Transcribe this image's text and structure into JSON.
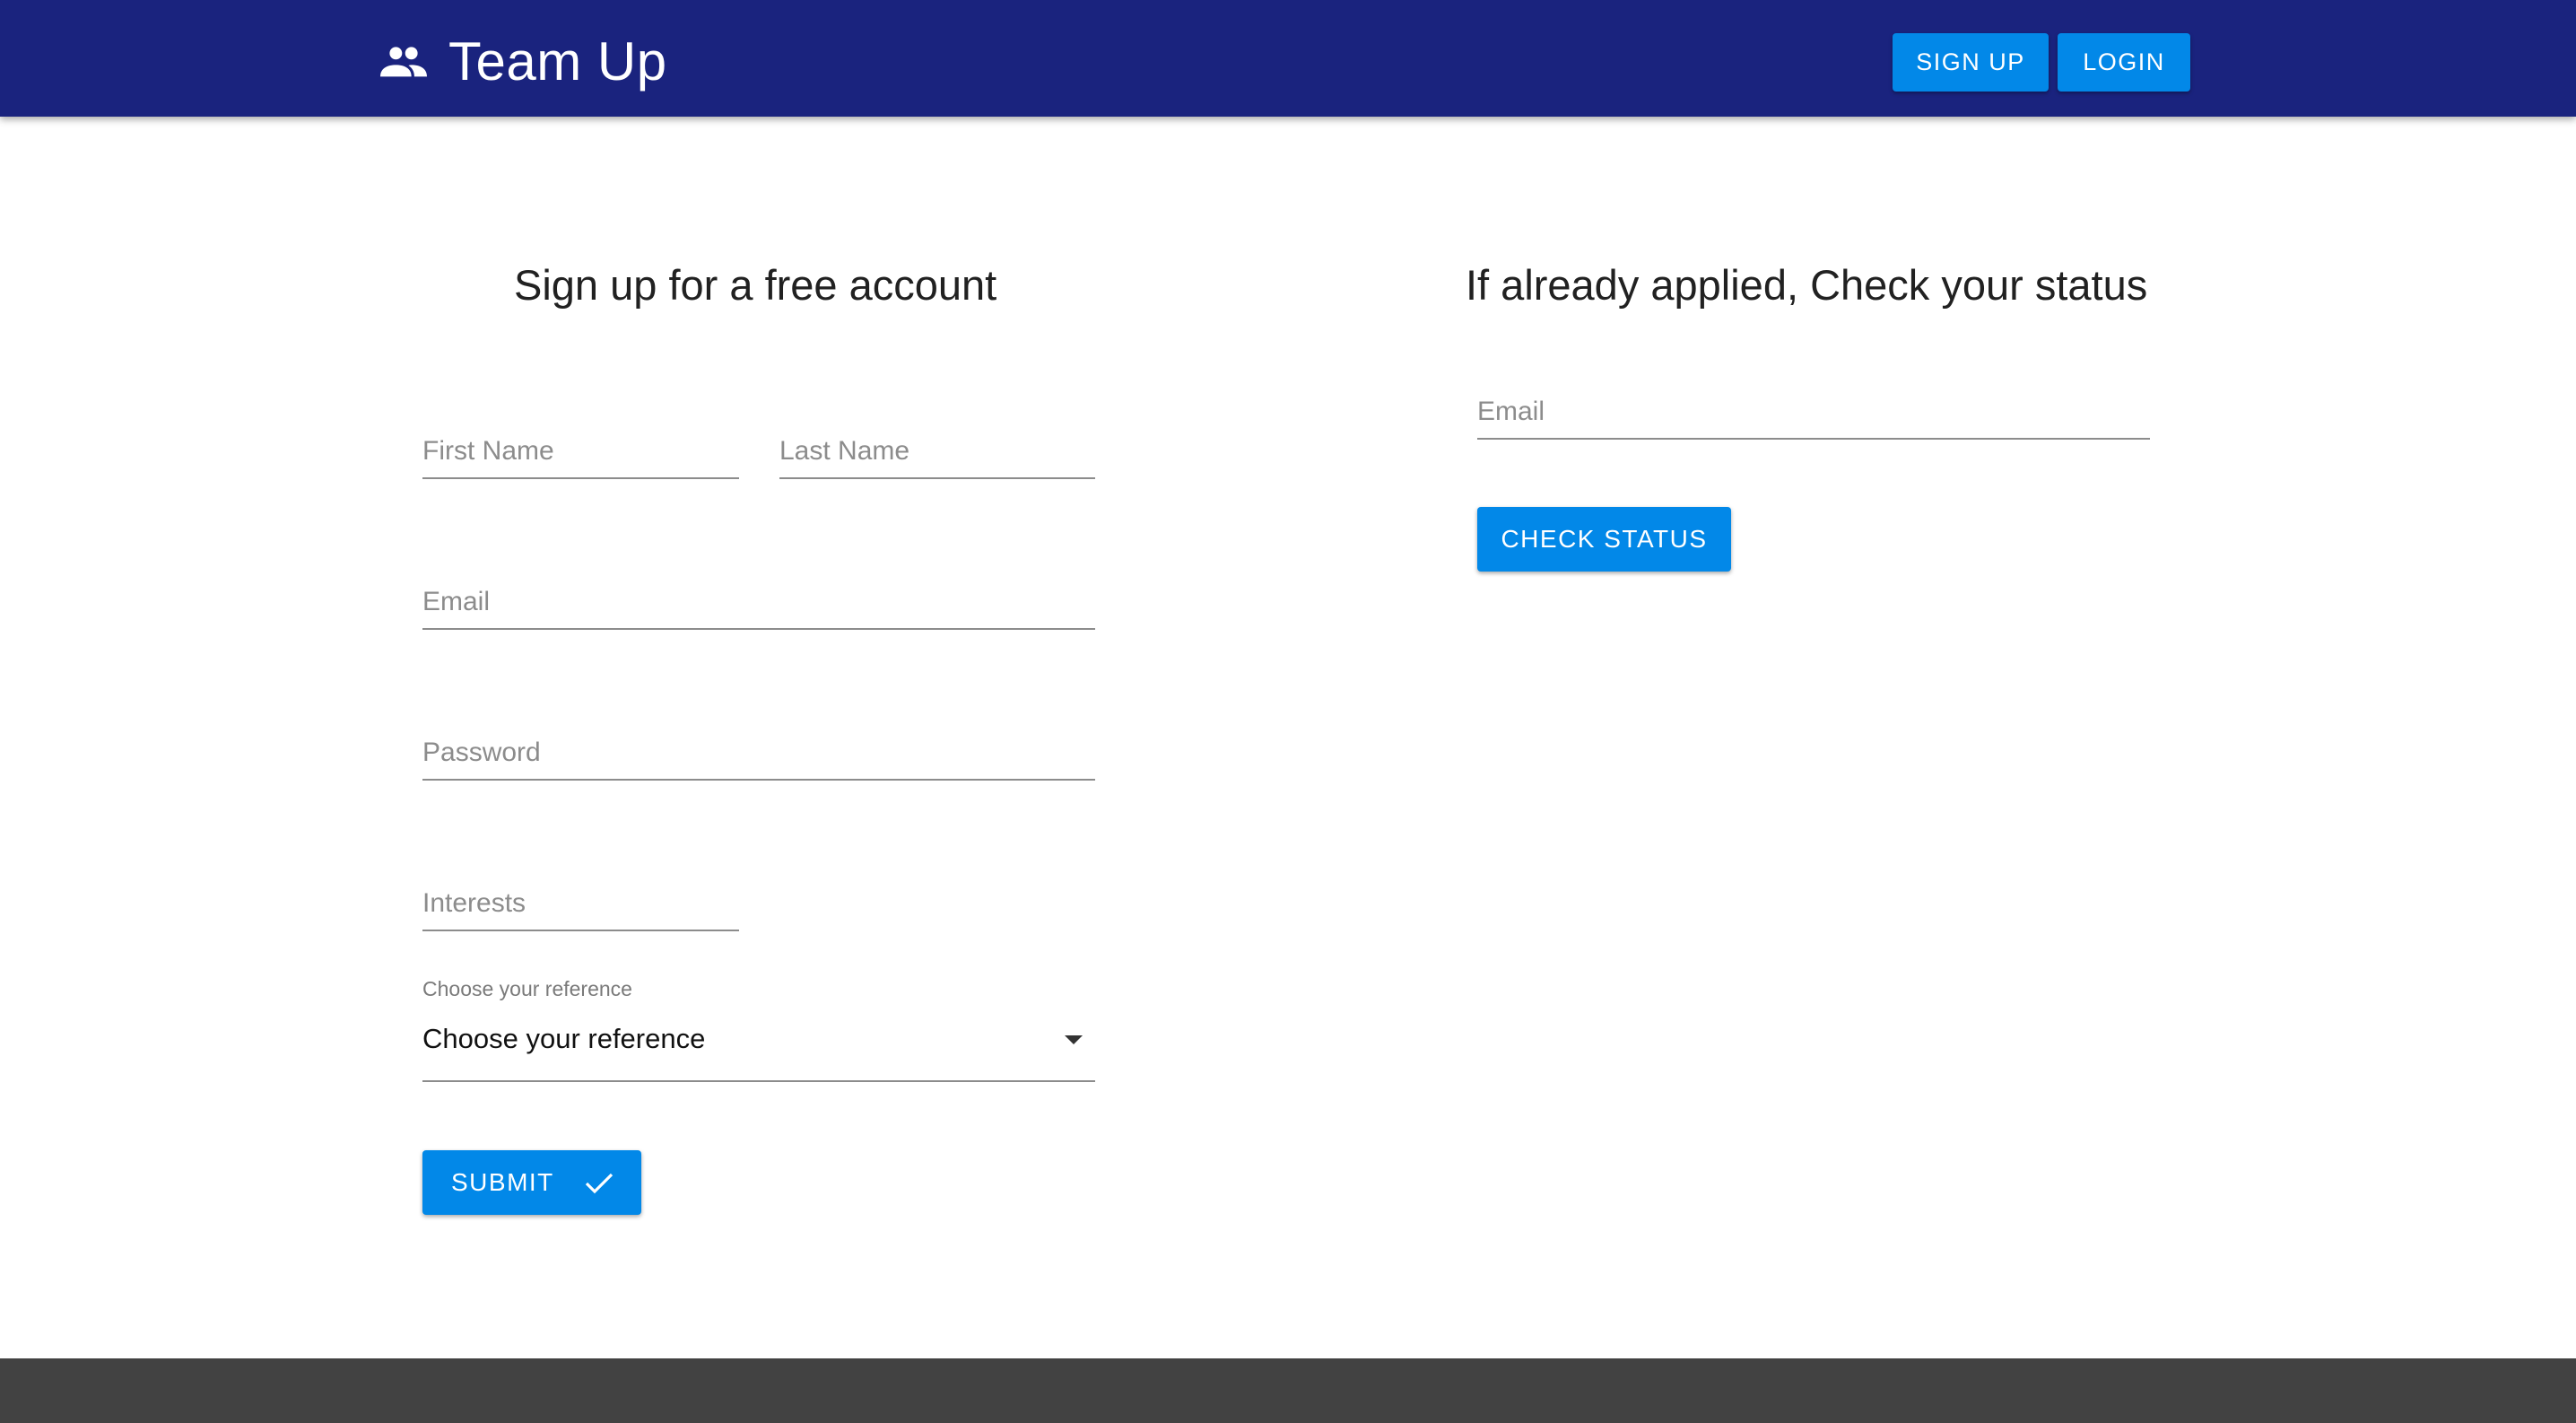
{
  "header": {
    "brand_icon": "people-icon",
    "title": "Team Up",
    "signup_label": "SIGN UP",
    "login_label": "LOGIN",
    "background": "#1a237e"
  },
  "signup": {
    "title": "Sign up for a free account",
    "first_name_placeholder": "First Name",
    "last_name_placeholder": "Last Name",
    "email_placeholder": "Email",
    "password_placeholder": "Password",
    "interests_placeholder": "Interests",
    "reference": {
      "label": "Choose your reference",
      "selected": "Choose your reference",
      "icon": "arrow-drop-down-icon"
    },
    "submit_label": "SUBMIT",
    "submit_icon": "check-icon"
  },
  "status": {
    "title": "If already applied, Check your status",
    "email_placeholder": "Email",
    "check_label": "CHECK STATUS"
  },
  "colors": {
    "primary": "#0288e8",
    "footer": "#424242"
  }
}
